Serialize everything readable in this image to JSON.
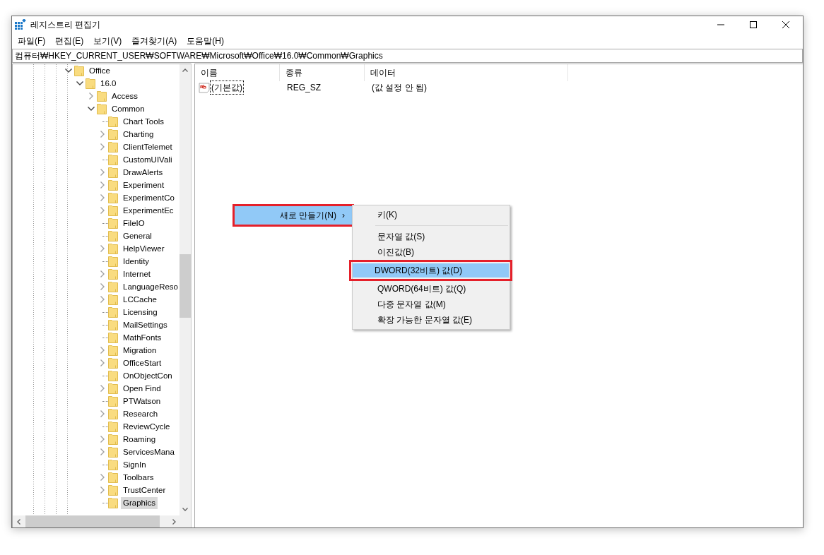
{
  "window": {
    "title": "레지스트리 편집기"
  },
  "menu_bar": [
    "파일(F)",
    "편집(E)",
    "보기(V)",
    "즐겨찾기(A)",
    "도움말(H)"
  ],
  "address": "컴퓨터₩HKEY_CURRENT_USER₩SOFTWARE₩Microsoft₩Office₩16.0₩Common₩Graphics",
  "tree": [
    {
      "label": "Office",
      "has_subkeys": true,
      "expanded": true,
      "selected": false,
      "children": [
        {
          "label": "16.0",
          "has_subkeys": true,
          "expanded": true,
          "selected": false,
          "children": [
            {
              "label": "Access",
              "has_subkeys": true,
              "expanded": false,
              "selected": false
            },
            {
              "label": "Common",
              "has_subkeys": true,
              "expanded": true,
              "selected": false,
              "children": [
                {
                  "label": "Chart Tools",
                  "has_subkeys": false,
                  "selected": false
                },
                {
                  "label": "Charting",
                  "has_subkeys": true,
                  "expanded": false,
                  "selected": false
                },
                {
                  "label": "ClientTelemet",
                  "has_subkeys": true,
                  "expanded": false,
                  "selected": false
                },
                {
                  "label": "CustomUIVali",
                  "has_subkeys": false,
                  "selected": false
                },
                {
                  "label": "DrawAlerts",
                  "has_subkeys": true,
                  "expanded": false,
                  "selected": false
                },
                {
                  "label": "Experiment",
                  "has_subkeys": true,
                  "expanded": false,
                  "selected": false
                },
                {
                  "label": "ExperimentCo",
                  "has_subkeys": true,
                  "expanded": false,
                  "selected": false
                },
                {
                  "label": "ExperimentEc",
                  "has_subkeys": true,
                  "expanded": false,
                  "selected": false
                },
                {
                  "label": "FileIO",
                  "has_subkeys": false,
                  "selected": false
                },
                {
                  "label": "General",
                  "has_subkeys": false,
                  "selected": false
                },
                {
                  "label": "HelpViewer",
                  "has_subkeys": true,
                  "expanded": false,
                  "selected": false
                },
                {
                  "label": "Identity",
                  "has_subkeys": false,
                  "selected": false
                },
                {
                  "label": "Internet",
                  "has_subkeys": true,
                  "expanded": false,
                  "selected": false
                },
                {
                  "label": "LanguageReso",
                  "has_subkeys": true,
                  "expanded": false,
                  "selected": false
                },
                {
                  "label": "LCCache",
                  "has_subkeys": true,
                  "expanded": false,
                  "selected": false
                },
                {
                  "label": "Licensing",
                  "has_subkeys": false,
                  "selected": false
                },
                {
                  "label": "MailSettings",
                  "has_subkeys": false,
                  "selected": false
                },
                {
                  "label": "MathFonts",
                  "has_subkeys": false,
                  "selected": false
                },
                {
                  "label": "Migration",
                  "has_subkeys": true,
                  "expanded": false,
                  "selected": false
                },
                {
                  "label": "OfficeStart",
                  "has_subkeys": true,
                  "expanded": false,
                  "selected": false
                },
                {
                  "label": "OnObjectCon",
                  "has_subkeys": false,
                  "selected": false
                },
                {
                  "label": "Open Find",
                  "has_subkeys": true,
                  "expanded": false,
                  "selected": false
                },
                {
                  "label": "PTWatson",
                  "has_subkeys": false,
                  "selected": false
                },
                {
                  "label": "Research",
                  "has_subkeys": true,
                  "expanded": false,
                  "selected": false
                },
                {
                  "label": "ReviewCycle",
                  "has_subkeys": false,
                  "selected": false
                },
                {
                  "label": "Roaming",
                  "has_subkeys": true,
                  "expanded": false,
                  "selected": false
                },
                {
                  "label": "ServicesMana",
                  "has_subkeys": true,
                  "expanded": false,
                  "selected": false
                },
                {
                  "label": "SignIn",
                  "has_subkeys": false,
                  "selected": false
                },
                {
                  "label": "Toolbars",
                  "has_subkeys": true,
                  "expanded": false,
                  "selected": false
                },
                {
                  "label": "TrustCenter",
                  "has_subkeys": true,
                  "expanded": false,
                  "selected": false
                },
                {
                  "label": "Graphics",
                  "has_subkeys": false,
                  "selected": true
                }
              ]
            }
          ]
        }
      ]
    }
  ],
  "list": {
    "columns": [
      "이름",
      "종류",
      "데이터"
    ],
    "rows": [
      {
        "name": "(기본값)",
        "type": "REG_SZ",
        "data": "(값 설정 안 됨)"
      }
    ]
  },
  "context_menu": {
    "label": "새로 만들기(N)",
    "arrow": "›",
    "selected": true,
    "highlighted": true,
    "submenu": [
      {
        "kind": "item",
        "label": "키(K)",
        "selected": false,
        "highlighted": false
      },
      {
        "kind": "separator"
      },
      {
        "kind": "item",
        "label": "문자열 값(S)",
        "selected": false,
        "highlighted": false
      },
      {
        "kind": "item",
        "label": "이진값(B)",
        "selected": false,
        "highlighted": false
      },
      {
        "kind": "item",
        "label": "DWORD(32비트) 값(D)",
        "selected": true,
        "highlighted": true
      },
      {
        "kind": "item",
        "label": "QWORD(64비트) 값(Q)",
        "selected": false,
        "highlighted": false
      },
      {
        "kind": "item",
        "label": "다중 문자열 값(M)",
        "selected": false,
        "highlighted": false
      },
      {
        "kind": "item",
        "label": "확장 가능한 문자열 값(E)",
        "selected": false,
        "highlighted": false
      }
    ]
  }
}
